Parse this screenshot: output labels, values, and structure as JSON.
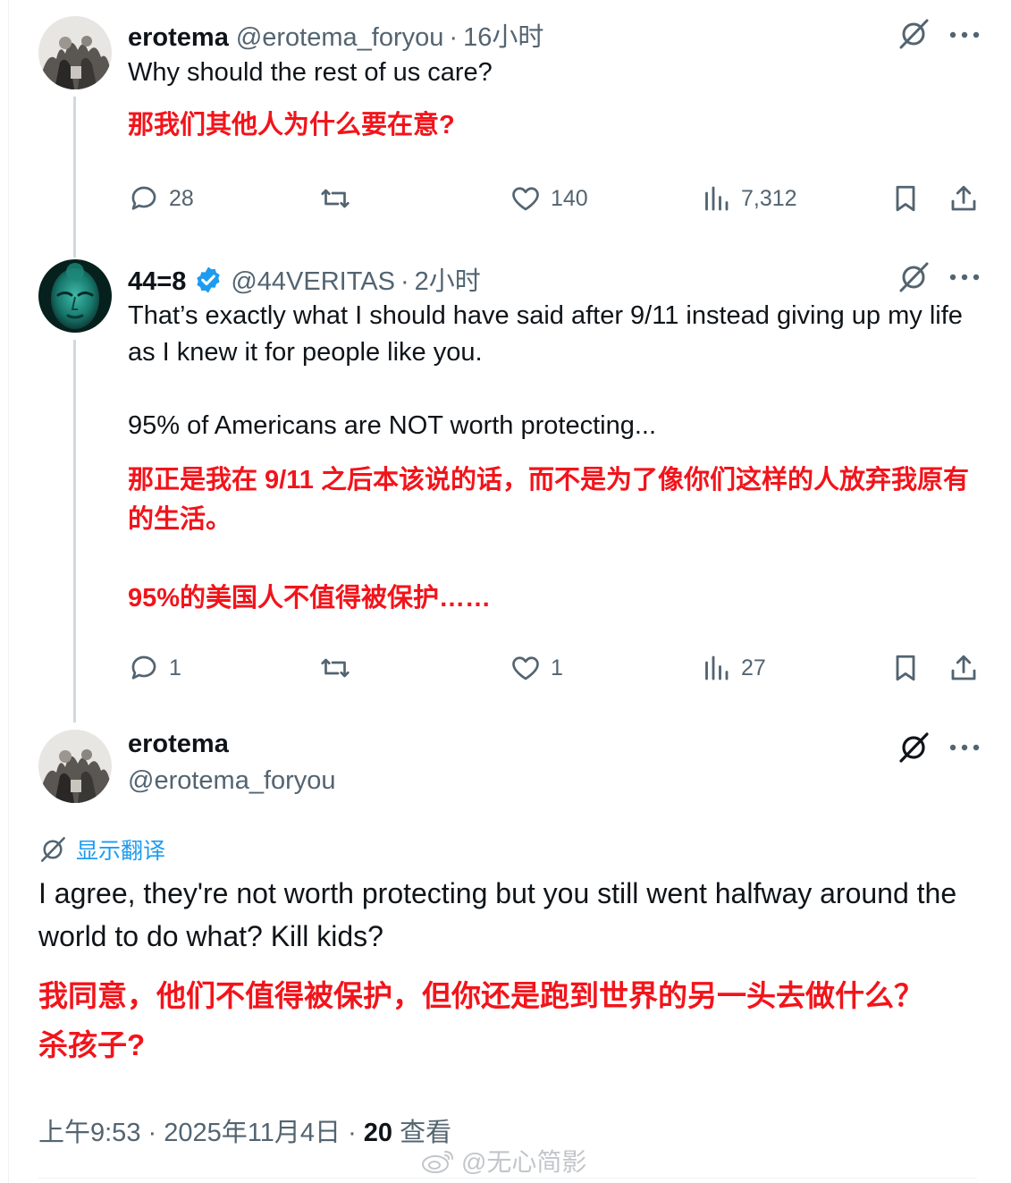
{
  "tweets": [
    {
      "display_name": "erotema",
      "handle": "@erotema_foryou",
      "dot": "·",
      "time": "16小时",
      "text_en": "Why should the rest of us care?",
      "text_zh": "那我们其他人为什么要在意?",
      "replies": "28",
      "likes": "140",
      "views": "7,312"
    },
    {
      "display_name": "44=8",
      "verified": true,
      "handle": "@44VERITAS",
      "dot": "·",
      "time": "2小时",
      "text_en": "That’s exactly what I should have said after 9/11 instead giving up my life as I knew it for people like you.\n\n95% of Americans are NOT worth protecting...",
      "text_zh": "那正是我在 9/11 之后本该说的话，而不是为了像你们这样的人放弃我原有的生活。\n\n95%的美国人不值得被保护……",
      "replies": "1",
      "likes": "1",
      "views": "27"
    }
  ],
  "main_tweet": {
    "display_name": "erotema",
    "handle": "@erotema_foryou",
    "translate_label": "显示翻译",
    "text_en": "I agree, they're not worth protecting but you still went halfway around the world to do what? Kill kids?",
    "text_zh": "我同意，他们不值得被保护，但你还是跑到世界的另一头去做什么？杀孩子?",
    "time": "上午9:53",
    "dot": "·",
    "date": "2025年11月4日",
    "view_count": "20",
    "views_label": "查看"
  },
  "watermark": "@无心简影",
  "icons": {
    "reply": "reply-icon",
    "repost": "repost-icon",
    "like": "heart-icon",
    "views": "views-chart-icon",
    "bookmark": "bookmark-icon",
    "share": "share-icon",
    "grok": "grok-icon",
    "more": "more-dots-icon",
    "verified": "verified-badge-icon",
    "translate": "translate-icon"
  },
  "colors": {
    "text": "#0f1419",
    "secondary": "#536471",
    "translation_red": "#f2141b",
    "link_blue": "#1d9bf0",
    "thread_line": "#cfd9de"
  }
}
